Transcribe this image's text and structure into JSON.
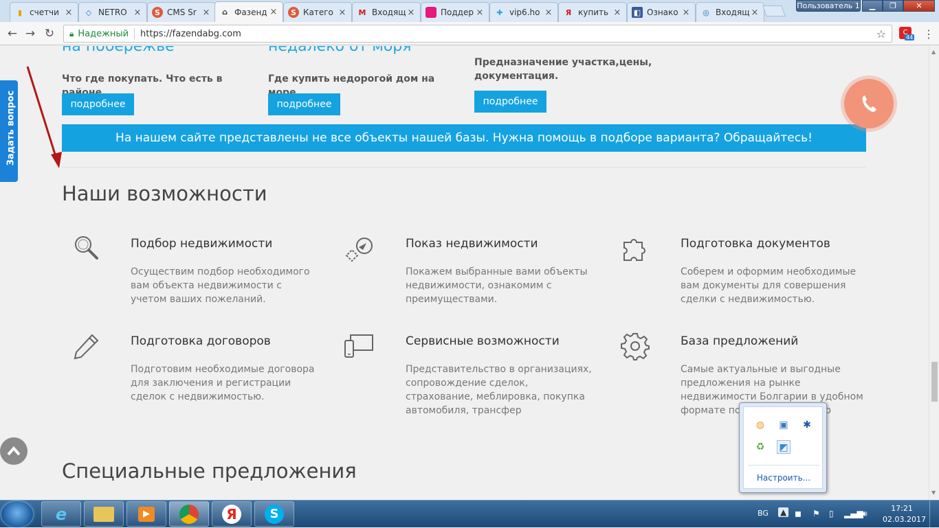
{
  "browser": {
    "tabs": [
      {
        "label": "счетчи",
        "icon": "chart-favicon",
        "color": "#e8a400"
      },
      {
        "label": "NETRO",
        "icon": "diamond-favicon",
        "color": "#3b6fc0"
      },
      {
        "label": "CMS Sr",
        "icon": "s-favicon",
        "color": "#e05a3a"
      },
      {
        "label": "Фазенд",
        "icon": "home-favicon",
        "color": "#333333"
      },
      {
        "label": "Катего",
        "icon": "s-favicon",
        "color": "#e05a3a"
      },
      {
        "label": "Входящ",
        "icon": "gmail-favicon",
        "color": "#c5221f"
      },
      {
        "label": "Поддер",
        "icon": "pink-favicon",
        "color": "#e5197e"
      },
      {
        "label": "vip6.ho",
        "icon": "arrows-favicon",
        "color": "#2aa4e0"
      },
      {
        "label": "купить",
        "icon": "yandex-favicon",
        "color": "#d51b1b"
      },
      {
        "label": "Ознако",
        "icon": "blue-favicon",
        "color": "#3b5a9a"
      },
      {
        "label": "Входящ",
        "icon": "mail-favicon",
        "color": "#1e6fb8"
      }
    ],
    "user_label": "Пользователь 1",
    "secure_label": "Надежный",
    "url": "https://fazendabg.com",
    "ext_badge": "44"
  },
  "page": {
    "top_cut_links": [
      "на побережье",
      "недалеко от моря"
    ],
    "columns": [
      {
        "subtitle": "Что где покупать. Что есть в районе.",
        "button": "подробнее"
      },
      {
        "subtitle": "Где купить недорогой дом на море.",
        "button": "подробнее"
      },
      {
        "subtitle": "Предназначение участка,цены, документация.",
        "button": "подробнее"
      }
    ],
    "banner": "На нашем сайте представлены не все объекты нашей базы. Нужна помощь в подборе варианта? Обращайтесь!",
    "features_title": "Наши возможности",
    "features": [
      {
        "icon": "search-icon",
        "title": "Подбор недвижимости",
        "desc": "Осуществим подбор необходимого вам объекта недвижимости с учетом ваших пожеланий."
      },
      {
        "icon": "brush-icon",
        "title": "Показ недвижимости",
        "desc": "Покажем выбранные вами объекты недвижимости, ознакомим с преимуществами."
      },
      {
        "icon": "puzzle-icon",
        "title": "Подготовка документов",
        "desc": "Соберем и оформим необходимые вам документы для совершения сделки с недвижимостью."
      },
      {
        "icon": "pencil-icon",
        "title": "Подготовка договоров",
        "desc": "Подготовим необходимые договора для заключения и регистрации сделок с недвижимостью."
      },
      {
        "icon": "devices-icon",
        "title": "Сервисные возможности",
        "desc": "Представительство в организациях, сопровождение сделок, страхование, меблировка, покупка автомобиля, трансфер"
      },
      {
        "icon": "gear-icon",
        "title": "База предложений",
        "desc": "Самые актуальные и выгодные предложения на рынке недвижимости Болгарии в удобном формате поиска по вашим кр"
      }
    ],
    "special_title": "Специальные предложения",
    "ask_label": "Задать вопрос"
  },
  "tray_popup": {
    "customize": "Настроить..."
  },
  "taskbar": {
    "lang": "BG",
    "time": "17:21",
    "date": "02.03.2017"
  },
  "colors": {
    "accent": "#15a2e0",
    "phone": "#f1947a",
    "ask": "#1b82d8"
  }
}
